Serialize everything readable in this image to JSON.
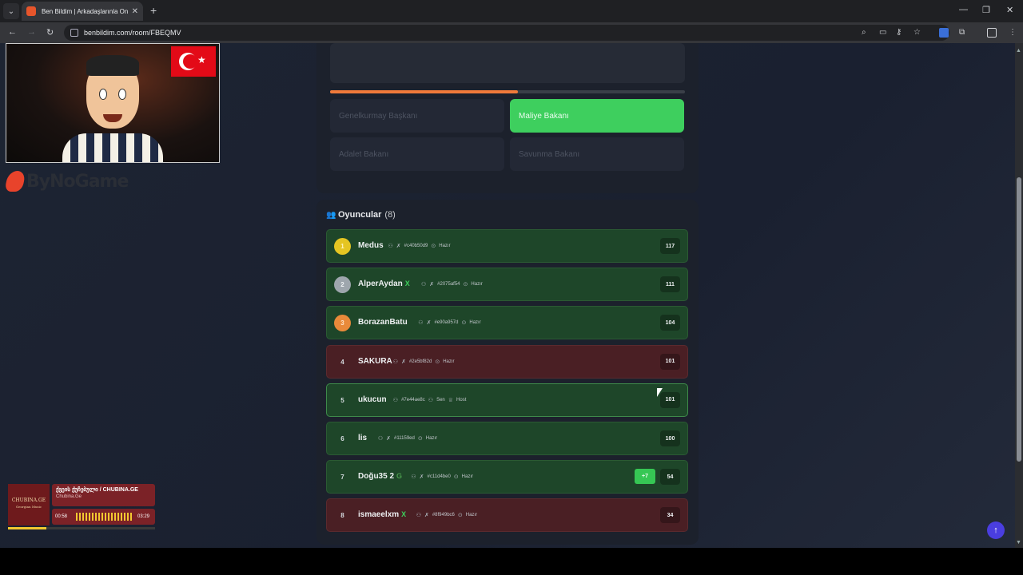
{
  "browser": {
    "tab_title": "Ben Bildim | Arkadaşlarınla Online",
    "url": "benbildim.com/room/FBEQMV",
    "new_tab": "+",
    "tab_close": "✕"
  },
  "quiz": {
    "progress_percent": 53,
    "options": [
      {
        "label": "Genelkurmay Başkanı",
        "state": "disabled"
      },
      {
        "label": "Maliye Bakanı",
        "state": "correct"
      },
      {
        "label": "Adalet Bakanı",
        "state": "disabled"
      },
      {
        "label": "Savunma Bakanı",
        "state": "disabled"
      }
    ]
  },
  "players": {
    "title": "Oyuncular",
    "count": "(8)",
    "list": [
      {
        "rank": "1",
        "name": "Medus",
        "hash": "#c40b50d9",
        "status": "Hazır",
        "score": "117",
        "tone": "green",
        "medal": "gold"
      },
      {
        "rank": "2",
        "name": "AlperAydan",
        "hash": "#2075af54",
        "status": "Hazır",
        "score": "111",
        "tone": "green",
        "medal": "silver",
        "badge": "x"
      },
      {
        "rank": "3",
        "name": "BorazanBatu",
        "hash": "#e90a957d",
        "status": "Hazır",
        "score": "104",
        "tone": "green",
        "medal": "bronze"
      },
      {
        "rank": "4",
        "name": "SAKURA",
        "hash": "#2e5bf82d",
        "status": "Hazır",
        "score": "101",
        "tone": "red",
        "medal": "plain"
      },
      {
        "rank": "5",
        "name": "ukucun",
        "hash": "#7e44ae8c",
        "you_label": "Sen",
        "host_label": "Host",
        "score": "101",
        "tone": "green",
        "medal": "plain"
      },
      {
        "rank": "6",
        "name": "lis",
        "hash": "#11159ed",
        "status": "Hazır",
        "score": "100",
        "tone": "green",
        "medal": "plain"
      },
      {
        "rank": "7",
        "name": "Doğu35 2",
        "hash": "#c11d4be0",
        "status": "Hazır",
        "score": "54",
        "tone": "green",
        "medal": "plain",
        "badge": "g",
        "gain": "+7"
      },
      {
        "rank": "8",
        "name": "ismaeelxm",
        "hash": "#8f949bc6",
        "status": "Hazır",
        "score": "34",
        "tone": "red",
        "medal": "plain",
        "badge": "x"
      }
    ]
  },
  "overlay": {
    "logo_text": "ByNoGame",
    "music": {
      "art_title": "CHUBINA.GE",
      "art_sub": "Georgian Music",
      "title": "ქვეის ქუჩებული / CHUBINA.GE",
      "source": "Chubina.Ge",
      "time_current": "00:58",
      "time_total": "03:29",
      "progress_fraction": 0.26
    }
  },
  "colors": {
    "accent_orange": "#f07a3a",
    "correct_green": "#3ecf5e",
    "row_green": "#1e4629",
    "row_red": "#4a1f24"
  }
}
